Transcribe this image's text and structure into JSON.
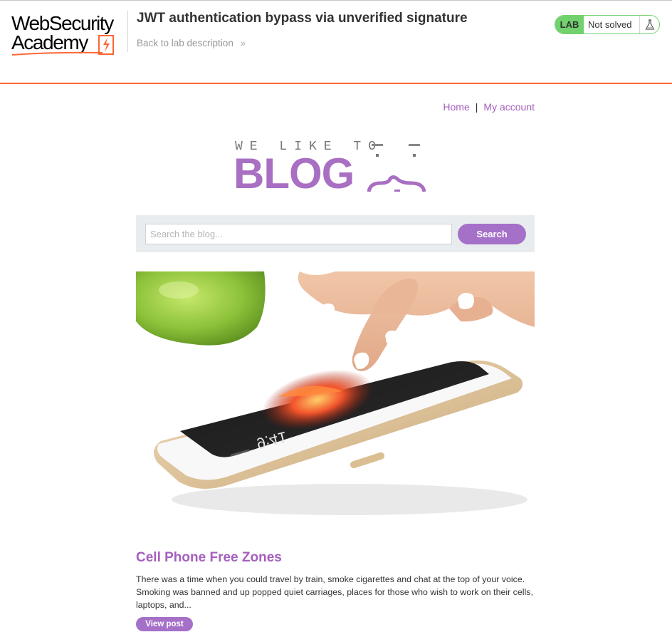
{
  "academy": {
    "logo_line1": "WebSecurity",
    "logo_line2": "Academy",
    "lab_title": "JWT authentication bypass via unverified signature",
    "back_link": "Back to lab description",
    "lab_badge": "LAB",
    "lab_state": "Not solved",
    "colors": {
      "accent": "#ff6633",
      "status_green": "#70d16d"
    }
  },
  "nav": {
    "home": "Home",
    "separator": "|",
    "my_account": "My account"
  },
  "banner": {
    "top_text": "WE LIKE TO",
    "main_text": "BLOG",
    "color": "#a86fc2"
  },
  "search": {
    "placeholder": "Search the blog...",
    "button_label": "Search"
  },
  "post": {
    "image_alt": "Cell Phone Free Zones",
    "title": "Cell Phone Free Zones",
    "summary": "There was a time when you could travel by train, smoke cigarettes and chat at the top of your voice. Smoking was banned and up popped quiet carriages, places for those who wish to work on their cells, laptops, and...",
    "view_label": "View post",
    "phone_time": "9:41"
  },
  "icons": [
    "flask-icon",
    "chevron-double-right-icon",
    "lightning-bolt-icon"
  ]
}
